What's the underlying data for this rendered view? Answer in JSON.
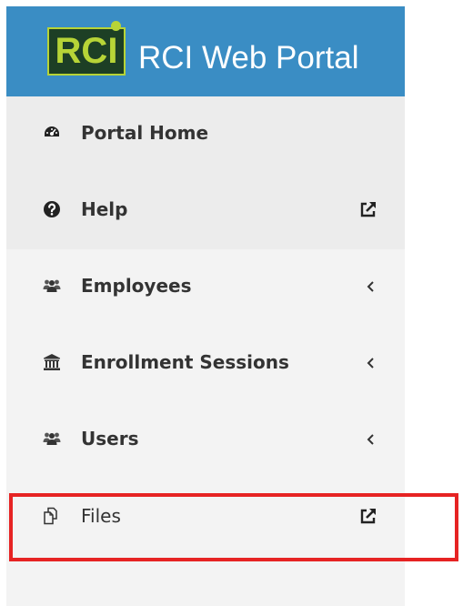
{
  "header": {
    "logo_text": "RCI",
    "title": "RCI Web Portal",
    "bg_color": "#3a8dc4"
  },
  "nav": {
    "items": [
      {
        "label": "Portal Home",
        "icon": "dashboard-icon",
        "right": ""
      },
      {
        "label": "Help",
        "icon": "question-circle-icon",
        "right": "external-link-icon"
      },
      {
        "label": "Employees",
        "icon": "users-icon",
        "right": "chevron-left-icon"
      },
      {
        "label": "Enrollment Sessions",
        "icon": "bank-icon",
        "right": "chevron-left-icon"
      },
      {
        "label": "Users",
        "icon": "users-icon",
        "right": "chevron-left-icon"
      },
      {
        "label": "Files",
        "icon": "files-icon",
        "right": "external-link-icon"
      }
    ]
  },
  "highlight": {
    "color": "#e62323",
    "target": "Files"
  }
}
